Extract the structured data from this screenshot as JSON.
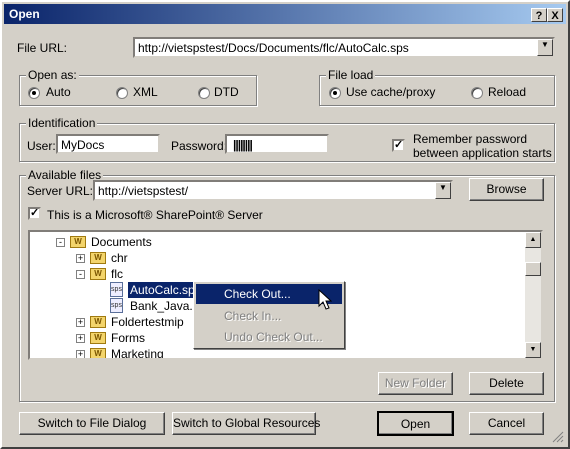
{
  "window": {
    "title": "Open",
    "help_button": "?",
    "close_button": "X"
  },
  "file_url": {
    "label": "File URL:",
    "value": "http://vietspstest/Docs/Documents/flc/AutoCalc.sps"
  },
  "open_as": {
    "label": "Open as:",
    "options": [
      "Auto",
      "XML",
      "DTD"
    ],
    "selected": "Auto"
  },
  "file_load": {
    "label": "File load",
    "options": [
      "Use cache/proxy",
      "Reload"
    ],
    "selected": "Use cache/proxy"
  },
  "identification": {
    "label": "Identification",
    "user_label": "User:",
    "user_value": "MyDocs",
    "password_label": "Password:",
    "password_value": "||||||||",
    "remember_line1": "Remember password",
    "remember_line2": "between application starts",
    "remember_checked": true
  },
  "available_files": {
    "label": "Available files",
    "server_label": "Server URL:",
    "server_value": "http://vietspstest/",
    "browse_button": "Browse",
    "sharepoint_label": "This is a Microsoft® SharePoint® Server",
    "sharepoint_checked": true
  },
  "tree": {
    "documents": "Documents",
    "chr": "chr",
    "flc": "flc",
    "autocalc": "AutoCalc.sps",
    "bankjava": "Bank_Java.sr",
    "foldertestmip": "Foldertestmip",
    "forms": "Forms",
    "marketing": "Marketing"
  },
  "context_menu": [
    "Check Out...",
    "Check In...",
    "Undo Check Out..."
  ],
  "buttons": {
    "new_folder": "New Folder",
    "delete": "Delete",
    "switch_file": "Switch to File Dialog",
    "switch_global": "Switch to Global Resources",
    "open": "Open",
    "cancel": "Cancel"
  },
  "icons": {
    "folder": "W",
    "expand": "+",
    "collapse": "-"
  },
  "colors": {
    "title_bar": "#0a246a",
    "selection": "#0a246a",
    "face": "#d4d0c8"
  }
}
